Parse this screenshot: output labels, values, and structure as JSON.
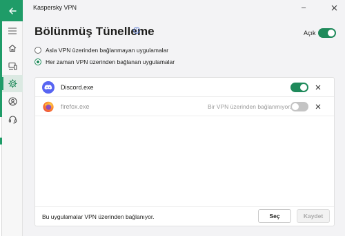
{
  "window": {
    "title": "Kaspersky VPN",
    "minimize_glyph": "–",
    "close_glyph": "✕"
  },
  "sidebar": {
    "items": [
      {
        "icon": "back-arrow-icon"
      },
      {
        "icon": "menu-icon"
      },
      {
        "icon": "home-icon"
      },
      {
        "icon": "devices-icon"
      },
      {
        "icon": "settings-icon",
        "active": true
      },
      {
        "icon": "profile-icon"
      },
      {
        "icon": "support-icon"
      }
    ]
  },
  "header": {
    "title": "Bölünmüş Tünelleme",
    "toggle_label": "Açık",
    "toggle_on": true
  },
  "options": {
    "never_vpn": "Asla VPN üzerinden bağlanmayan uygulamalar",
    "always_vpn": "Her zaman VPN üzerinden bağlanan uygulamalar",
    "selected": "always_vpn"
  },
  "apps": [
    {
      "name": "Discord.exe",
      "status": "",
      "enabled": true
    },
    {
      "name": "firefox.exe",
      "status": "Bir VPN üzerinden bağlanmıyor.",
      "enabled": false
    }
  ],
  "footer": {
    "text": "Bu uygulamalar VPN üzerinden bağlanıyor.",
    "select_label": "Seç",
    "save_label": "Kaydet"
  },
  "colors": {
    "accent": "#1f9c68",
    "toggle_on": "#1f8a5b",
    "discord": "#5865f2"
  }
}
